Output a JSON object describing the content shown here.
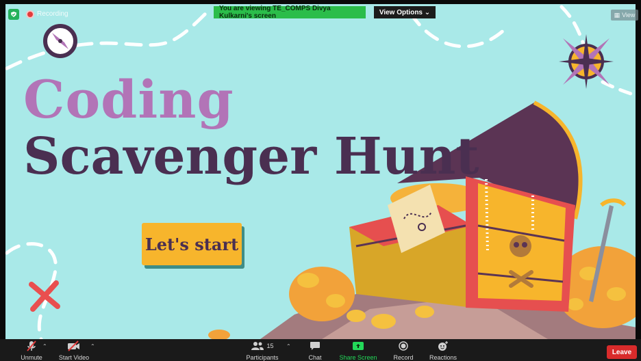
{
  "screen_share": {
    "recording_label": "Recording",
    "viewing_banner": "You are viewing TE_COMPS Divya Kulkarni's screen",
    "view_options_label": "View Options ⌄",
    "view_button_label": "View"
  },
  "slide": {
    "title_line1": "Coding",
    "title_line2": "Scavenger Hunt",
    "start_button_label": "Let's start"
  },
  "toolbar": {
    "unmute_label": "Unmute",
    "start_video_label": "Start Video",
    "participants_label": "Participants",
    "participants_count": "15",
    "chat_label": "Chat",
    "share_screen_label": "Share Screen",
    "record_label": "Record",
    "reactions_label": "Reactions",
    "leave_label": "Leave"
  },
  "colors": {
    "slide_bg": "#a9e9e8",
    "title_purple": "#b274b7",
    "title_dark": "#4a2f51",
    "button_yellow": "#f7b52c",
    "banner_green": "#2bbd4a",
    "leave_red": "#d92b2b",
    "share_green": "#23d959"
  }
}
